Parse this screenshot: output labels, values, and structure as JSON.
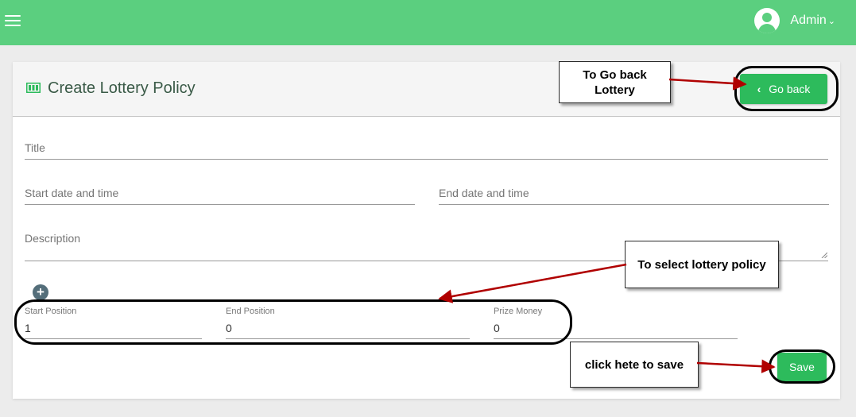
{
  "header": {
    "user_name": "Admin",
    "caret": "⌄"
  },
  "page": {
    "title": "Create Lottery Policy"
  },
  "buttons": {
    "go_back": "Go back",
    "go_back_icon": "‹",
    "save": "Save",
    "add_icon": "+"
  },
  "form": {
    "title_placeholder": "Title",
    "start_placeholder": "Start date and time",
    "end_placeholder": "End date and time",
    "description_placeholder": "Description"
  },
  "policy_row": {
    "start_label": "Start Position",
    "start_value": "1",
    "end_label": "End Position",
    "end_value": "0",
    "prize_label": "Prize Money",
    "prize_value": "0"
  },
  "annotations": {
    "go_back_note": "To Go back\nLottery",
    "select_note": "To select lottery policy",
    "save_note": "click hete to save"
  },
  "colors": {
    "topbar": "#5bcf7f",
    "button": "#2dbb5c",
    "arrow": "#b00000"
  }
}
